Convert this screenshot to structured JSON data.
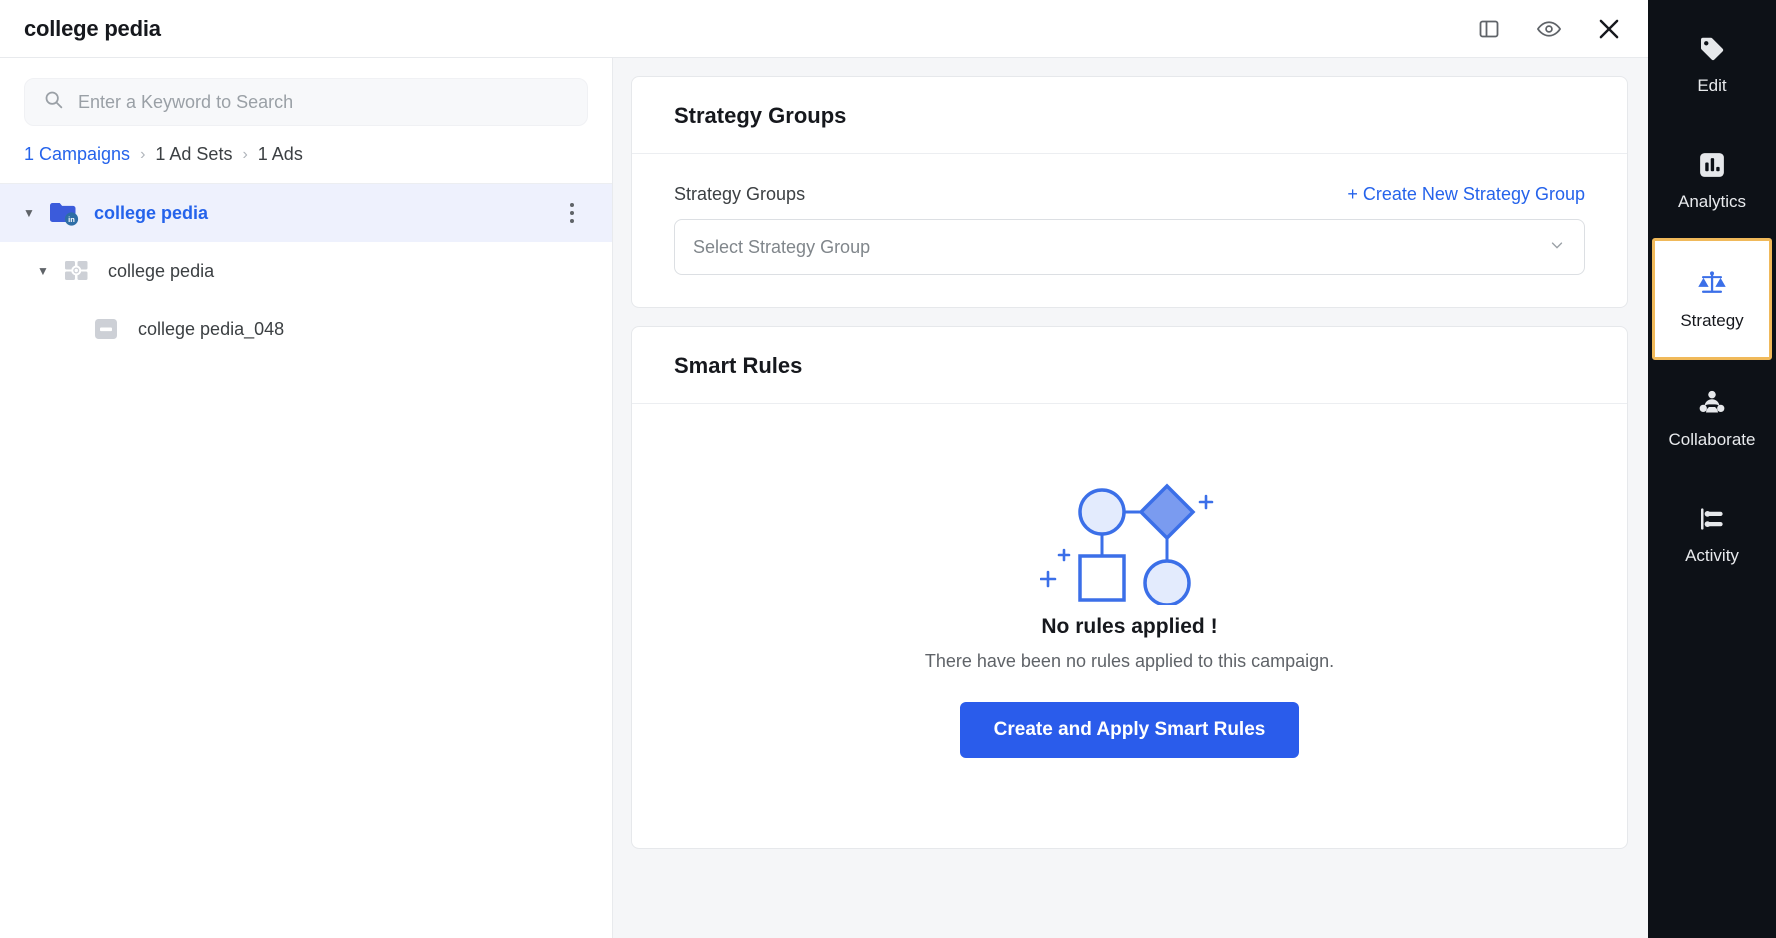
{
  "header": {
    "title": "college pedia",
    "actions": [
      {
        "name": "panel-toggle-icon",
        "label": "Toggle Panel"
      },
      {
        "name": "preview-eye-icon",
        "label": "Preview"
      },
      {
        "name": "close-icon",
        "label": "Close"
      }
    ]
  },
  "left_panel": {
    "search": {
      "value": "",
      "placeholder": "Enter a Keyword to Search",
      "icon": "search-icon"
    },
    "breadcrumb": [
      {
        "label": "1 Campaigns",
        "active": true
      },
      {
        "label": "1 Ad Sets",
        "active": false
      },
      {
        "label": "1 Ads",
        "active": false
      }
    ],
    "breadcrumb_separator": "›",
    "tree": [
      {
        "label": "college pedia",
        "level": 0,
        "icon": "campaign-folder-linkedin-icon",
        "expanded": true,
        "selected": true,
        "has_menu": true
      },
      {
        "label": "college pedia",
        "level": 1,
        "icon": "adset-grid-icon",
        "expanded": true,
        "selected": false,
        "has_menu": false
      },
      {
        "label": "college pedia_048",
        "level": 2,
        "icon": "ad-creative-icon",
        "expanded": false,
        "selected": false,
        "has_menu": false
      }
    ]
  },
  "main": {
    "strategy_groups_card": {
      "title": "Strategy Groups",
      "field_label": "Strategy Groups",
      "create_link": "+ Create New Strategy Group",
      "select_placeholder": "Select Strategy Group",
      "select_value": ""
    },
    "smart_rules_card": {
      "title": "Smart Rules",
      "empty_title": "No rules applied !",
      "empty_subtitle": "There have been no rules applied to this campaign.",
      "cta_label": "Create and Apply Smart Rules",
      "illustration": "rules-flow-diagram-icon"
    }
  },
  "right_rail": {
    "items": [
      {
        "label": "Edit",
        "icon": "tag-icon",
        "active": false
      },
      {
        "label": "Analytics",
        "icon": "bar-chart-icon",
        "active": false
      },
      {
        "label": "Strategy",
        "icon": "scales-balance-icon",
        "active": true
      },
      {
        "label": "Collaborate",
        "icon": "people-group-icon",
        "active": false
      },
      {
        "label": "Activity",
        "icon": "sliders-icon",
        "active": false
      }
    ]
  },
  "colors": {
    "accent_blue": "#2563eb",
    "primary_button": "#2a5ceb",
    "rail_background": "#0d1117",
    "active_rail_border": "#f0b95a",
    "selected_row": "#eef1fd",
    "canvas": "#f5f6f8"
  }
}
